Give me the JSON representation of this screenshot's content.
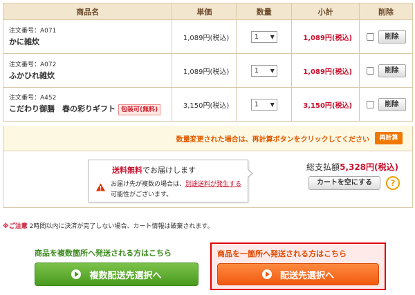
{
  "table": {
    "headers": [
      "商品名",
      "単価",
      "数量",
      "小計",
      "削除"
    ],
    "rows": [
      {
        "order_no": "注文番号：A071",
        "name": "かに雑炊",
        "badge": "",
        "price": "1,089円(税込)",
        "qty": "1",
        "subtotal": "1,089円(税込)",
        "delete_label": "削除"
      },
      {
        "order_no": "注文番号：A072",
        "name": "ふかひれ雑炊",
        "badge": "",
        "price": "1,089円(税込)",
        "qty": "1",
        "subtotal": "1,089円(税込)",
        "delete_label": "削除"
      },
      {
        "order_no": "注文番号：A452",
        "name": "こだわり御膳　春の彩りギフト",
        "badge": "包装可(無料)",
        "price": "3,150円(税込)",
        "qty": "1",
        "subtotal": "3,150円(税込)",
        "delete_label": "削除"
      }
    ]
  },
  "notice": {
    "text": "数量変更された場合は、再計算ボタンをクリックしてください",
    "recalc_label": "再計算"
  },
  "shipping_bubble": {
    "title_red": "送料無料",
    "title_rest": "でお届けします",
    "body_1": "お届け先が複数の場合は、",
    "body_link": "別途送料が発生する",
    "body_2": "可能性がございます。"
  },
  "summary": {
    "total_label": "総支払額",
    "total_amount": "5,328円(税込)",
    "empty_cart_label": "カートを空にする",
    "help_label": "?"
  },
  "caution": {
    "label": "※ご注意",
    "text": "2時間以内に決済が完了しない場合、カート情報は破棄されます。"
  },
  "shipping_options": {
    "multi_label": "商品を複数箇所へ発送される方はこちら",
    "multi_button": "複数配送先選択へ",
    "single_label": "商品を一箇所へ発送される方はこちら",
    "single_button": "配送先選択へ"
  },
  "colors": {
    "accent_red": "#c8102e",
    "header_bg": "#f3e6cf",
    "green_button": "#4a9a20",
    "orange_button": "#f05a10"
  }
}
